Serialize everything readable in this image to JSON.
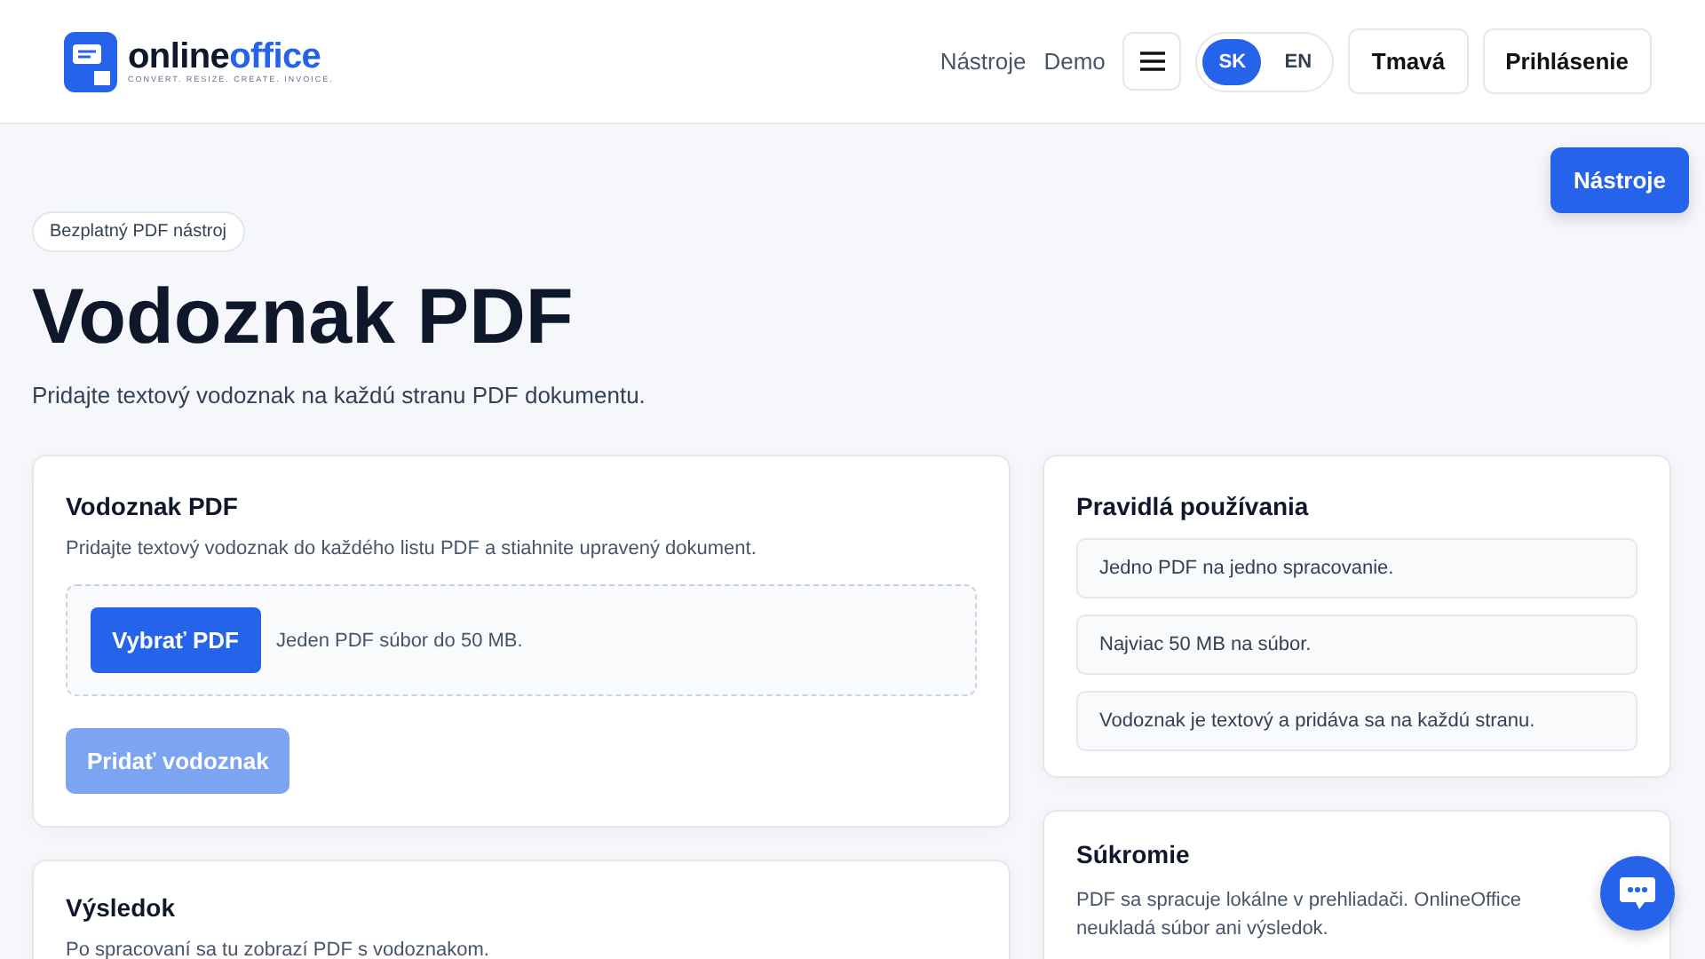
{
  "header": {
    "logo": {
      "word_1": "online",
      "word_2": "office",
      "tagline": "CONVERT. RESIZE. CREATE. INVOICE."
    },
    "nav_links": [
      "Nástroje",
      "Demo"
    ],
    "languages": [
      {
        "label": "SK",
        "selected": true
      },
      {
        "label": "EN",
        "selected": false
      }
    ],
    "theme_button": "Tmavá",
    "login_button": "Prihlásenie"
  },
  "floating_button": "Nástroje",
  "hero": {
    "badge": "Bezplatný PDF nástroj",
    "title": "Vodoznak PDF",
    "subtitle": "Pridajte textový vodoznak na každú stranu PDF dokumentu."
  },
  "tool_card": {
    "title": "Vodoznak PDF",
    "description": "Pridajte textový vodoznak do každého listu PDF a stiahnite upravený dokument.",
    "pick_button": "Vybrať PDF",
    "file_hint": "Jeden PDF súbor do 50 MB.",
    "submit_button": {
      "label": "Pridať vodoznak",
      "disabled": true
    }
  },
  "result_card": {
    "title": "Výsledok",
    "text": "Po spracovaní sa tu zobrazí PDF s vodoznakom."
  },
  "rules_card": {
    "title": "Pravidlá používania",
    "items": [
      "Jedno PDF na jedno spracovanie.",
      "Najviac 50 MB na súbor.",
      "Vodoznak je textový a pridáva sa na každú stranu."
    ]
  },
  "privacy_card": {
    "title": "Súkromie",
    "text": "PDF sa spracuje lokálne v prehliadači. OnlineOffice neukladá súbor ani výsledok."
  }
}
